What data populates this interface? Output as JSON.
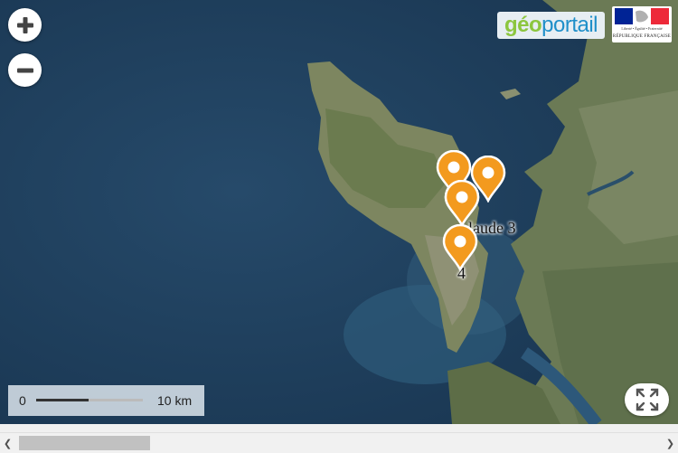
{
  "map": {
    "zoom_in_icon": "plus-icon",
    "zoom_out_icon": "minus-icon",
    "provider_logo": {
      "part1": "géo",
      "part2": "portail"
    },
    "government_logo": {
      "motto": "Liberté • Égalité • Fraternité",
      "name": "RÉPUBLIQUE FRANÇAISE"
    },
    "markers": [
      {
        "label": ""
      },
      {
        "label": ""
      },
      {
        "label": ""
      },
      {
        "label": "laude 3"
      },
      {
        "label": "4"
      }
    ],
    "marker_color": "#f39a1e",
    "scale": {
      "start": "0",
      "end": "10 km"
    },
    "fullscreen_icon": "fullscreen-icon"
  },
  "scrollbar": {
    "left_icon": "chevron-left-icon",
    "right_icon": "chevron-right-icon"
  }
}
